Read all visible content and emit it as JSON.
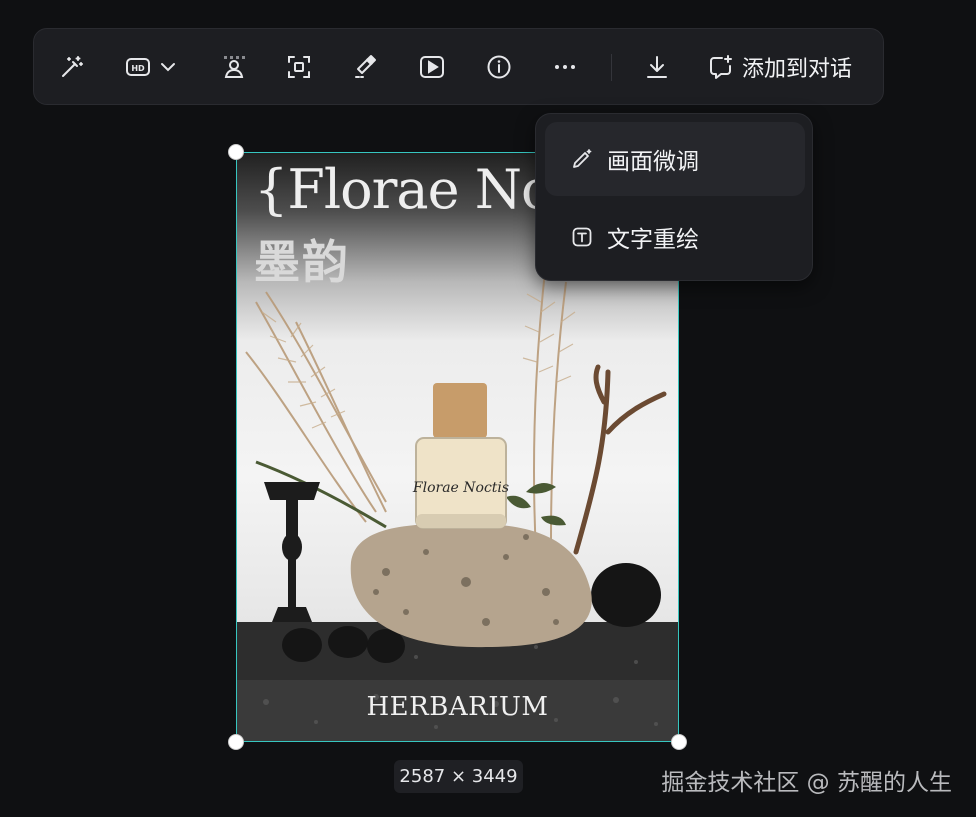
{
  "toolbar": {
    "buttons": [
      {
        "name": "magic-wand"
      },
      {
        "name": "hd-upscale"
      },
      {
        "name": "person-cutout"
      },
      {
        "name": "focus-frame"
      },
      {
        "name": "eraser"
      },
      {
        "name": "play-video"
      },
      {
        "name": "info"
      },
      {
        "name": "more"
      },
      {
        "name": "download"
      }
    ],
    "add_to_chat_label": "添加到对话"
  },
  "menu": {
    "items": [
      {
        "label": "画面微调",
        "icon": "pencil-sparkle-icon"
      },
      {
        "label": "文字重绘",
        "icon": "text-box-icon"
      }
    ]
  },
  "poster": {
    "title": "{Florae Noc",
    "subtitle_cn": "墨韵",
    "bottle_label": "Florae Noctis",
    "brand": "HERBARIUM"
  },
  "image": {
    "dimensions": "2587 × 3449"
  },
  "watermark": "掘金技术社区 @ 苏醒的人生",
  "colors": {
    "background": "#0f1012",
    "panel": "#1d1e22",
    "selection": "#37c6c0"
  }
}
